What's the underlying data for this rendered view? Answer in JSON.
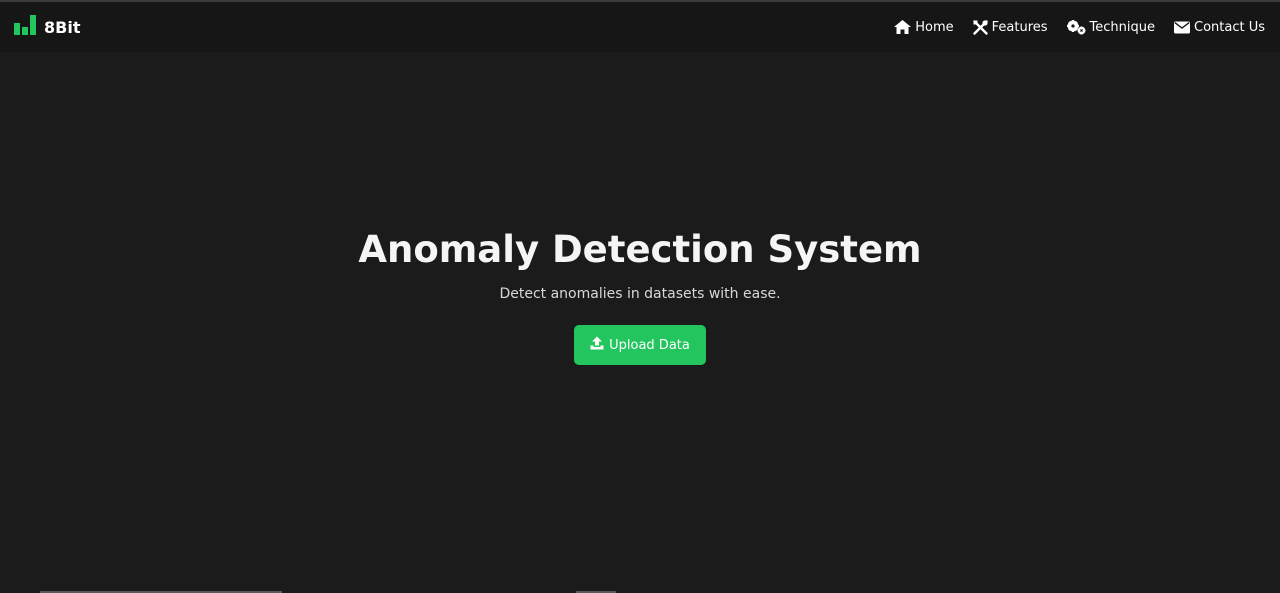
{
  "brand": {
    "name": "8Bit",
    "logo_icon": "bar-chart-icon",
    "logo_color": "#22c55e"
  },
  "nav": {
    "items": [
      {
        "label": "Home",
        "icon": "home-icon"
      },
      {
        "label": "Features",
        "icon": "tools-icon"
      },
      {
        "label": "Technique",
        "icon": "gears-icon"
      },
      {
        "label": "Contact Us",
        "icon": "envelope-icon"
      }
    ]
  },
  "hero": {
    "title": "Anomaly Detection System",
    "subtitle": "Detect anomalies in datasets with ease.",
    "button_label": "Upload Data",
    "button_icon": "upload-icon",
    "button_color": "#22c55e"
  },
  "colors": {
    "background": "#1b1b1b",
    "navbar": "#161616",
    "accent": "#22c55e"
  }
}
